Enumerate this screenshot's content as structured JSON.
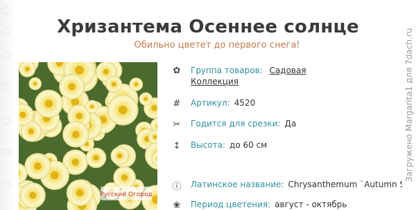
{
  "page": {
    "title": "Хризантема Осеннее солнце",
    "subtitle": "Обильно цветет до первого снега!"
  },
  "properties": {
    "group": {
      "label": "Группа товаров:",
      "value": "Садовая Коллекция",
      "icon": "flowers-icon"
    },
    "article": {
      "label": "Артикул:",
      "value": "4520",
      "icon": "hash-icon"
    },
    "cutting": {
      "label": "Годится для срезки:",
      "value": "Да",
      "icon": "scissors-icon"
    },
    "height": {
      "label": "Высота:",
      "value": "до 60 см",
      "icon": "height-arrow-icon"
    },
    "latin": {
      "label": "Латинское название:",
      "value": "Chrysanthemum `Autumn Sun",
      "icon": "info-icon"
    },
    "bloom": {
      "label": "Период цветения:",
      "value": "август - октябрь",
      "icon": "flower-icon"
    }
  },
  "photo": {
    "stamp": "Русский Огород"
  },
  "watermark": "Загружено Margarita1 для 7dach.ru",
  "colors": {
    "label": "#2f8fa0",
    "subtitle": "#c27a4e",
    "title": "#3a3a3a"
  }
}
